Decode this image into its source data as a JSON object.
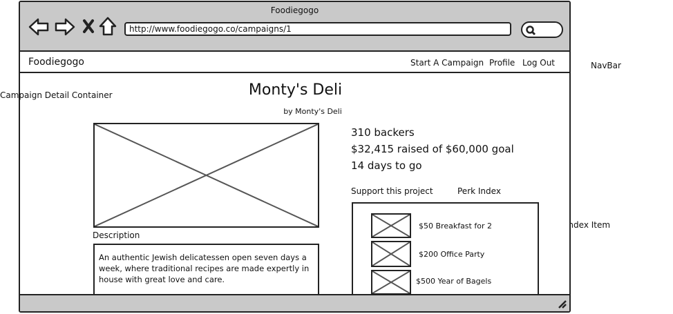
{
  "browser": {
    "window_title": "Foodiegogo",
    "url": "http://www.foodiegogo.co/campaigns/1"
  },
  "nav": {
    "brand": "Foodiegogo",
    "links": [
      "Start A Campaign",
      "Profile",
      "Log Out"
    ]
  },
  "campaign": {
    "title": "Monty's Deli",
    "byline": "by Monty's Deli",
    "backers": "310 backers",
    "raised": "$32,415 raised of $60,000 goal",
    "days_left": "14 days to go",
    "support_label": "Support this project",
    "perk_index_label": "Perk Index",
    "description_label": "Description",
    "description": "An authentic Jewish delicatessen open seven days a week, where traditional recipes are made expertly in house with great love and care."
  },
  "perks": [
    {
      "label": "$50 Breakfast for 2"
    },
    {
      "label": "$200 Office Party"
    },
    {
      "label": "$500 Year of Bagels"
    }
  ],
  "annotations": {
    "navbar": "NavBar",
    "container": "Campaign Detail Container",
    "perk_item": "Perk Index Item"
  }
}
